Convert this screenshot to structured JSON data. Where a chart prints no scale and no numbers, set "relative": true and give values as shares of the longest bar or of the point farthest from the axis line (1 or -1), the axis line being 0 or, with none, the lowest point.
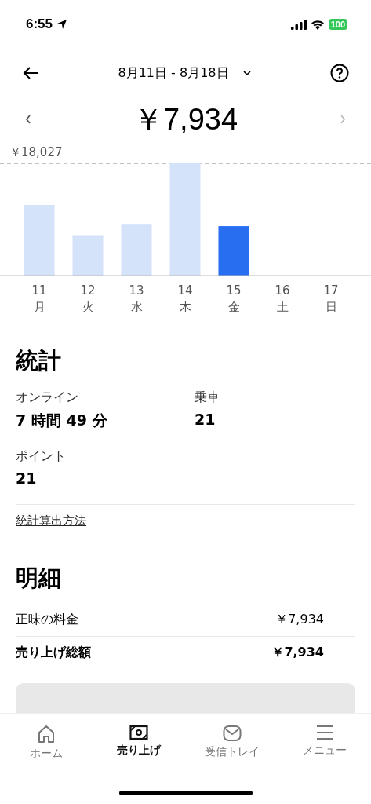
{
  "status_bar": {
    "time": "6:55",
    "battery": "100"
  },
  "header": {
    "date_range": "8月11日 - 8月18日",
    "total": "￥7,934"
  },
  "chart": {
    "chart_data": {
      "type": "bar",
      "categories": [
        "11\n月",
        "12\n火",
        "13\n水",
        "14\n木",
        "15\n金",
        "16\n土",
        "17\n日"
      ],
      "series": [
        {
          "color": "#d4e2fa",
          "values": [
            0.63,
            0.36,
            0.46,
            1,
            null,
            null,
            null
          ]
        },
        {
          "color": "#276ef1",
          "values": [
            null,
            null,
            null,
            null,
            0.44,
            null,
            null
          ]
        }
      ],
      "relative": true,
      "annotations": [
        {
          "text": "￥18,027"
        }
      ]
    }
  },
  "stats": {
    "title": "統計",
    "items": [
      {
        "label": "オンライン",
        "value": "7 時間 49 分"
      },
      {
        "label": "乗車",
        "value": "21"
      },
      {
        "label": "ポイント",
        "value": "21"
      }
    ],
    "link": "統計算出方法"
  },
  "details": {
    "title": "明細",
    "rows": [
      {
        "label": "正味の料金",
        "value": "￥7,934",
        "bold": false
      },
      {
        "label": "売り上げ総額",
        "value": "￥7,934",
        "bold": true
      }
    ]
  },
  "tab_bar": [
    {
      "label": "ホーム",
      "kind": "home",
      "selected": false
    },
    {
      "label": "売り上げ",
      "kind": "earnings",
      "selected": true
    },
    {
      "label": "受信トレイ",
      "kind": "inbox",
      "selected": false
    },
    {
      "label": "メニュー",
      "kind": "menu",
      "selected": false
    }
  ]
}
